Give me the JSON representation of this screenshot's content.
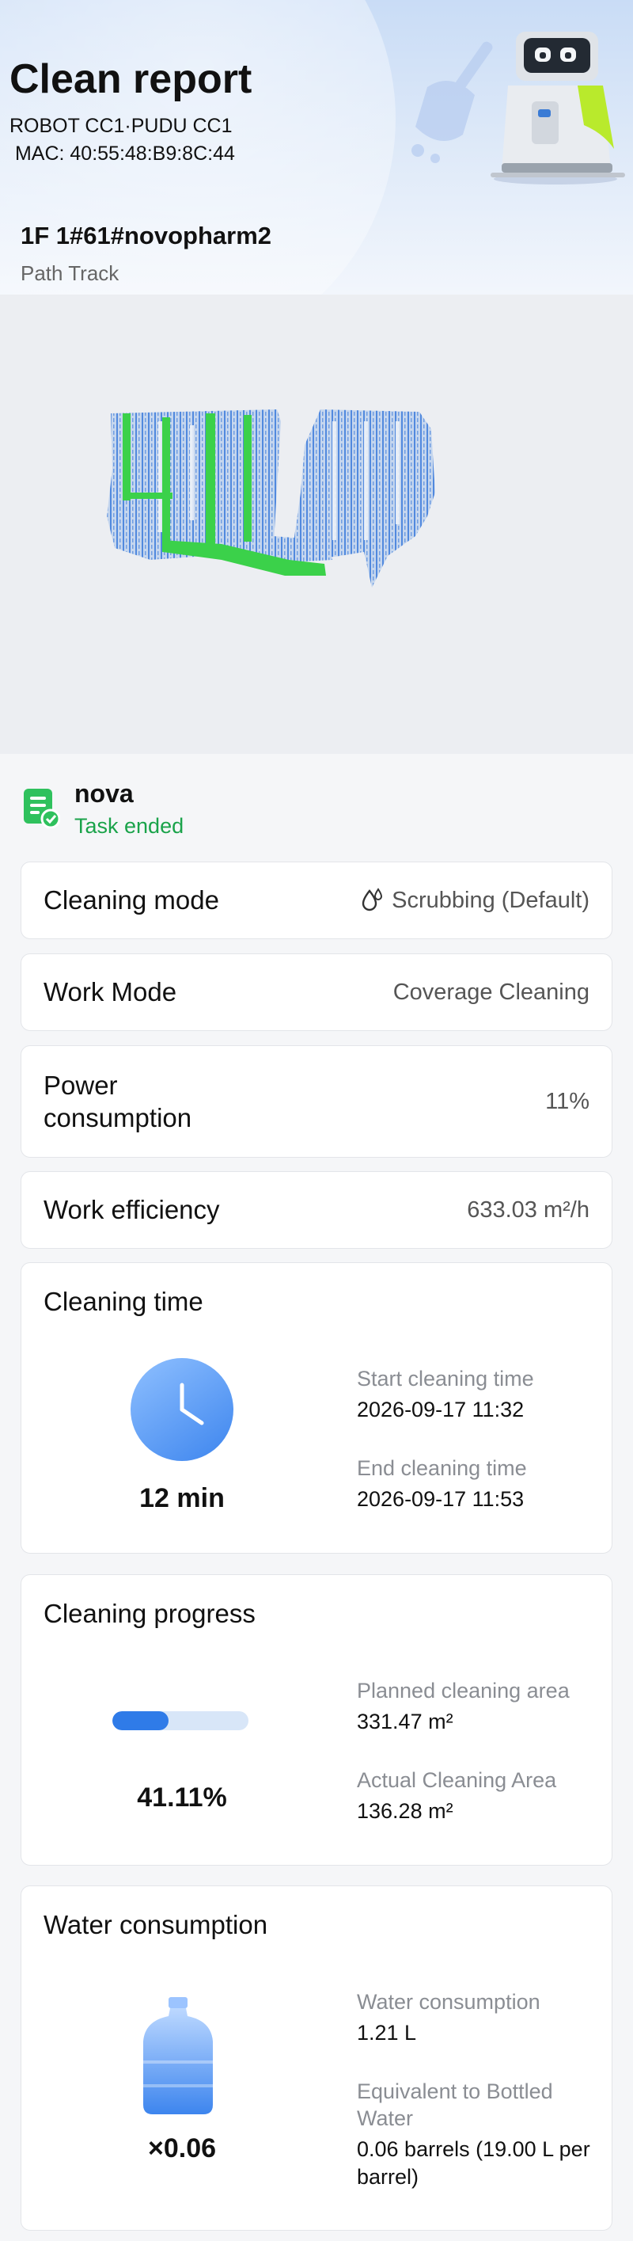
{
  "header": {
    "title": "Clean report",
    "robot": "ROBOT CC1·PUDU CC1",
    "mac": " MAC: 40:55:48:B9:8C:44"
  },
  "map": {
    "title": "1F 1#61#novopharm2",
    "subtitle": "Path Track"
  },
  "task": {
    "name": "nova",
    "status": "Task ended",
    "status_color": "#1aa34a"
  },
  "cleaning_mode": {
    "label": "Cleaning mode",
    "value": "Scrubbing (Default)",
    "icon": "water-drop-icon"
  },
  "work_mode": {
    "label": "Work Mode",
    "value": "Coverage Cleaning"
  },
  "power": {
    "label": "Power consumption",
    "value": "11%"
  },
  "efficiency": {
    "label": "Work efficiency",
    "value": "633.03 m²/h"
  },
  "cleaning_time": {
    "title": "Cleaning time",
    "duration": "12 min",
    "start_label": "Start cleaning time",
    "start_value": "2026-09-17 11:32",
    "end_label": "End cleaning time",
    "end_value": "2026-09-17 11:53"
  },
  "progress": {
    "title": "Cleaning progress",
    "percent_text": "41.11%",
    "percent": 41.11,
    "planned_label": "Planned cleaning area",
    "planned_value": "331.47 m²",
    "actual_label": "Actual Cleaning Area",
    "actual_value": "136.28 m²"
  },
  "water": {
    "title": "Water consumption",
    "multiplier": "×0.06",
    "consumption_label": "Water consumption",
    "consumption_value": "1.21 L",
    "equiv_label": "Equivalent to Bottled Water",
    "equiv_value": "0.06 barrels (19.00 L per barrel)"
  },
  "colors": {
    "accent_blue": "#2f7be8",
    "path_green": "#3bd14a",
    "map_blue": "#2b6fd8"
  }
}
